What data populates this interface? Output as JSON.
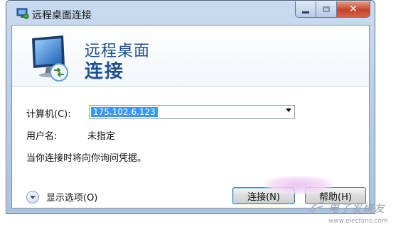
{
  "window": {
    "title": "远程桌面连接",
    "heading_line1": "远程桌面",
    "heading_line2": "连接"
  },
  "form": {
    "computer_label": "计算机(C):",
    "computer_value": "175.102.6.123",
    "username_label": "用户名:",
    "username_value": "未指定",
    "note": "当你连接时将向你询问凭据。"
  },
  "footer": {
    "options_label": "显示选项(O)",
    "connect_button": "连接(N)",
    "help_button": "帮助(H)"
  },
  "watermark": {
    "text": "电子发烧友",
    "url": "www.elecfans.com"
  },
  "colors": {
    "accent": "#1f4f8f",
    "selection": "#3399ff",
    "close_button": "#c2442b"
  },
  "icons": [
    "remote-desktop-icon",
    "monitor-icon",
    "chevron-down-icon",
    "minimize-icon",
    "maximize-icon",
    "close-icon"
  ]
}
